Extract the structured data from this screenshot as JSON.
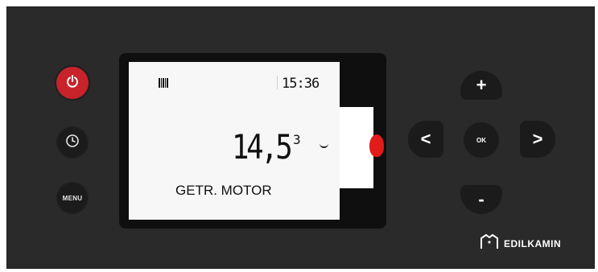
{
  "display": {
    "time": "15:36",
    "value": "14,5",
    "superscript": "3",
    "label": "GETR. MOTOR"
  },
  "buttons": {
    "power_icon": "power-icon",
    "clock_icon": "clock-icon",
    "menu_label": "MENU",
    "up_label": "+",
    "down_label": "-",
    "left_label": "<",
    "right_label": ">",
    "ok_label": "OK"
  },
  "brand": {
    "name": "EDILKAMIN"
  },
  "colors": {
    "panel": "#2a2a2a",
    "power": "#c8232a",
    "button": "#1b1b1b",
    "lcd": "#f7f7f7",
    "alert": "#e21b1b"
  }
}
